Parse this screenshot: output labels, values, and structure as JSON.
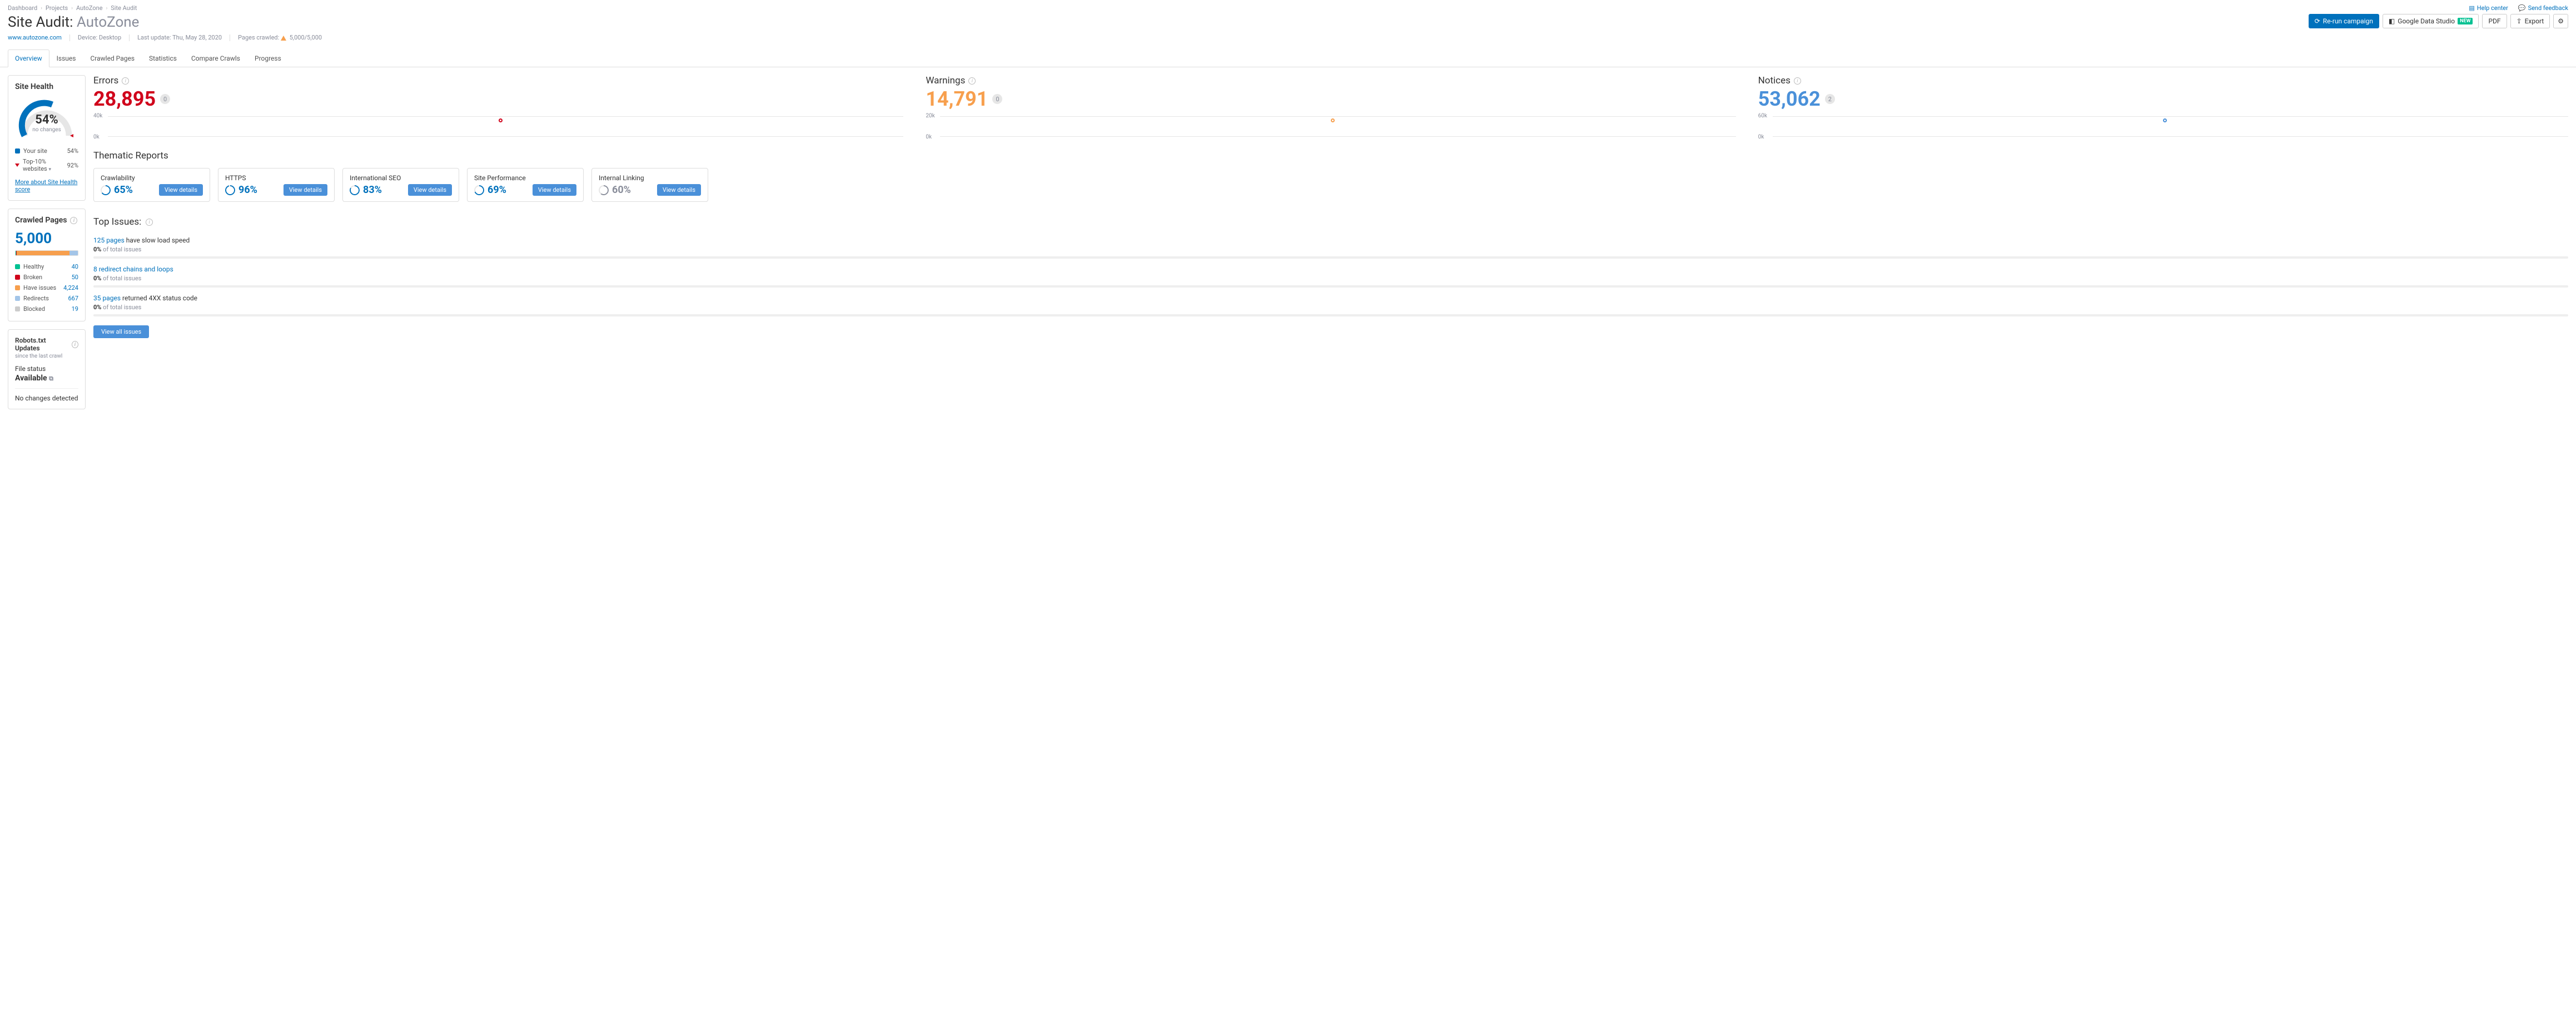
{
  "breadcrumbs": [
    "Dashboard",
    "Projects",
    "AutoZone",
    "Site Audit"
  ],
  "header_links": {
    "help": "Help center",
    "feedback": "Send feedback"
  },
  "page_title_prefix": "Site Audit:",
  "page_title_name": "AutoZone",
  "actions": {
    "rerun": "Re-run campaign",
    "gds": "Google Data Studio",
    "gds_badge": "NEW",
    "pdf": "PDF",
    "export": "Export"
  },
  "meta": {
    "domain": "www.autozone.com",
    "device_label": "Device:",
    "device_value": "Desktop",
    "last_update_label": "Last update:",
    "last_update_value": "Thu, May 28, 2020",
    "pages_crawled_label": "Pages crawled:",
    "pages_crawled_value": "5,000/5,000"
  },
  "tabs": [
    "Overview",
    "Issues",
    "Crawled Pages",
    "Statistics",
    "Compare Crawls",
    "Progress"
  ],
  "active_tab": 0,
  "site_health": {
    "title": "Site Health",
    "pct": "54%",
    "sub": "no changes",
    "legend": [
      {
        "label": "Your site",
        "value": "54%",
        "color": "#0071bc",
        "type": "sq"
      },
      {
        "label": "Top-10% websites",
        "value": "92%",
        "color": "#d0021b",
        "type": "tri",
        "dropdown": true
      }
    ],
    "more_link": "More about Site Health score"
  },
  "crawled_pages": {
    "title": "Crawled Pages",
    "number": "5,000",
    "breakdown": [
      {
        "label": "Healthy",
        "value": "40",
        "color": "#00c192",
        "pct": 0.8
      },
      {
        "label": "Broken",
        "value": "50",
        "color": "#d0021b",
        "pct": 1.0
      },
      {
        "label": "Have issues",
        "value": "4,224",
        "color": "#f79f4d",
        "pct": 84.5
      },
      {
        "label": "Redirects",
        "value": "667",
        "color": "#a3c5e8",
        "pct": 13.3
      },
      {
        "label": "Blocked",
        "value": "19",
        "color": "#ccc",
        "pct": 0.4
      }
    ]
  },
  "robots": {
    "title": "Robots.txt Updates",
    "sub": "since the last crawl",
    "file_status_label": "File status",
    "file_status_value": "Available",
    "no_changes": "No changes detected"
  },
  "metrics": [
    {
      "title": "Errors",
      "value": "28,895",
      "delta": "0",
      "color": "red",
      "y_top": "40k",
      "y_bot": "0k",
      "dot_color": "#d0021b"
    },
    {
      "title": "Warnings",
      "value": "14,791",
      "delta": "0",
      "color": "orange",
      "y_top": "20k",
      "y_bot": "0k",
      "dot_color": "#f79f4d"
    },
    {
      "title": "Notices",
      "value": "53,062",
      "delta": "2",
      "color": "blue",
      "y_top": "60k",
      "y_bot": "0k",
      "dot_color": "#4a90d9"
    }
  ],
  "thematic": {
    "title": "Thematic Reports",
    "button": "View details",
    "items": [
      {
        "name": "Crawlability",
        "pct": "65%",
        "accent": "#0071bc",
        "fill": 65
      },
      {
        "name": "HTTPS",
        "pct": "96%",
        "accent": "#0071bc",
        "fill": 96
      },
      {
        "name": "International SEO",
        "pct": "83%",
        "accent": "#0071bc",
        "fill": 83
      },
      {
        "name": "Site Performance",
        "pct": "69%",
        "accent": "#0071bc",
        "fill": 69
      },
      {
        "name": "Internal Linking",
        "pct": "60%",
        "accent": "#898d9a",
        "fill": 60,
        "grey": true
      }
    ]
  },
  "top_issues": {
    "title": "Top Issues:",
    "view_all": "View all issues",
    "of_total": "of total issues",
    "items": [
      {
        "link": "125 pages",
        "rest": " have slow load speed",
        "pct": "0%"
      },
      {
        "link": "8 redirect chains and loops",
        "rest": "",
        "pct": "0%"
      },
      {
        "link": "35 pages",
        "rest": " returned 4XX status code",
        "pct": "0%"
      }
    ]
  },
  "chart_data": {
    "type": "bar",
    "note": "three single-point sparkline metrics",
    "series": [
      {
        "name": "Errors",
        "values": [
          28895
        ],
        "ylim": [
          0,
          40000
        ]
      },
      {
        "name": "Warnings",
        "values": [
          14791
        ],
        "ylim": [
          0,
          20000
        ]
      },
      {
        "name": "Notices",
        "values": [
          53062
        ],
        "ylim": [
          0,
          60000
        ]
      }
    ]
  }
}
